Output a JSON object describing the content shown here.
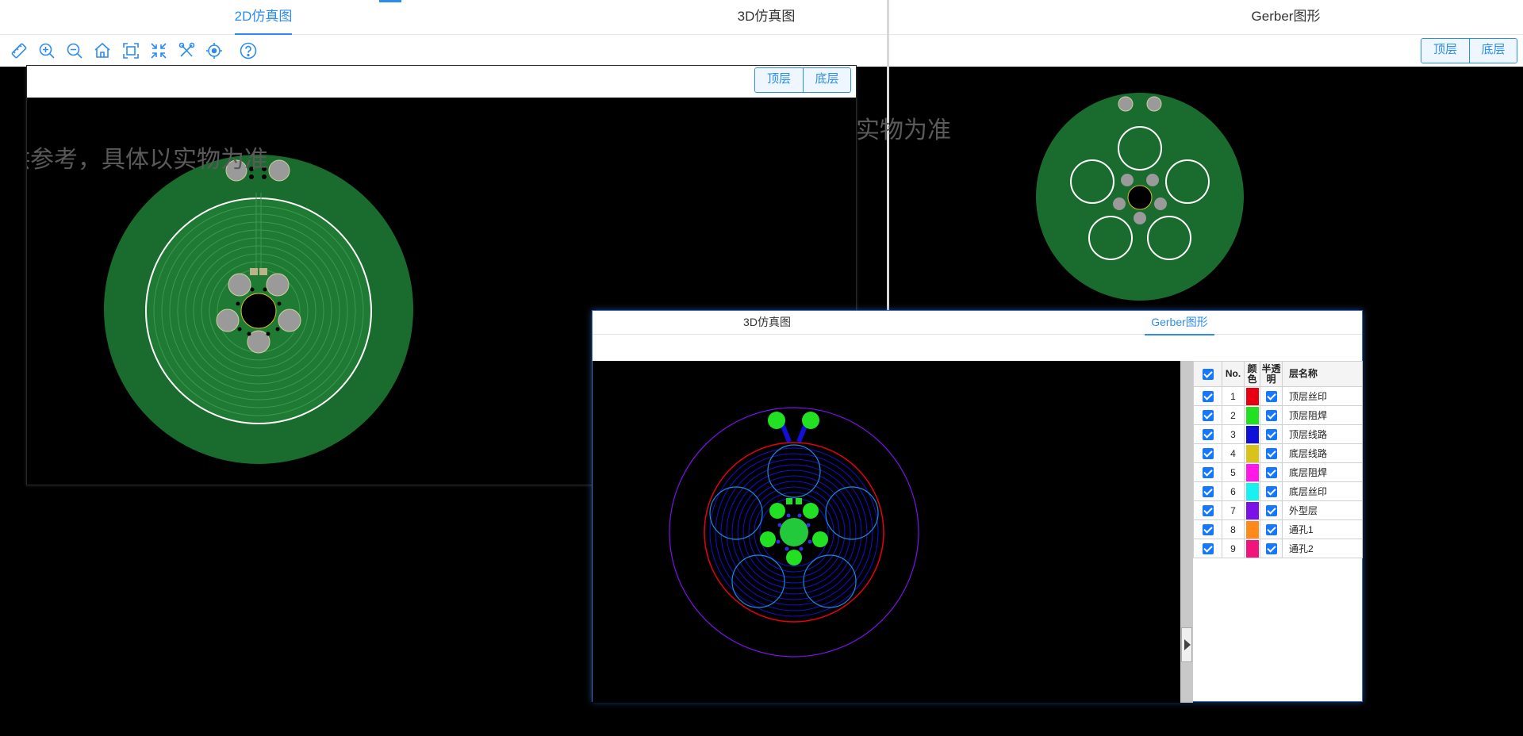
{
  "left_tabs": [
    {
      "label": "2D仿真图",
      "active": true
    },
    {
      "label": "3D仿真图",
      "active": false
    }
  ],
  "right_tabs": [
    {
      "label": "Gerber图形",
      "active": false
    }
  ],
  "toolbar_icons": [
    "ruler-icon",
    "zoom-in-icon",
    "zoom-out-icon",
    "home-icon",
    "fit-screen-icon",
    "shrink-icon",
    "tools-icon",
    "locate-icon",
    "help-icon"
  ],
  "panel2d": {
    "top_label": "顶层",
    "bottom_label": "底层",
    "watermark_left": "供参考，具体以实物为准",
    "watermark_right": "实物为准"
  },
  "right_view": {
    "top_label": "顶层",
    "bottom_label": "底层"
  },
  "dialog": {
    "tabs": [
      {
        "label": "3D仿真图",
        "active": false
      },
      {
        "label": "Gerber图形",
        "active": true
      }
    ],
    "table_headers": {
      "no": "No.",
      "color": "颜色",
      "translucent": "半透明",
      "name": "层名称"
    },
    "layers": [
      {
        "no": "1",
        "color": "#e60012",
        "name": "顶层丝印"
      },
      {
        "no": "2",
        "color": "#22e022",
        "name": "顶层阻焊"
      },
      {
        "no": "3",
        "color": "#1010d8",
        "name": "顶层线路"
      },
      {
        "no": "4",
        "color": "#d9c21a",
        "name": "底层线路"
      },
      {
        "no": "5",
        "color": "#ff18e6",
        "name": "底层阻焊"
      },
      {
        "no": "6",
        "color": "#19f0f0",
        "name": "底层丝印"
      },
      {
        "no": "7",
        "color": "#7a12e8",
        "name": "外型层"
      },
      {
        "no": "8",
        "color": "#ff8a1a",
        "name": "通孔1"
      },
      {
        "no": "9",
        "color": "#f0157a",
        "name": "通孔2"
      }
    ]
  },
  "colors": {
    "accent": "#2d8cf0",
    "board_green": "#1a6b2e"
  }
}
